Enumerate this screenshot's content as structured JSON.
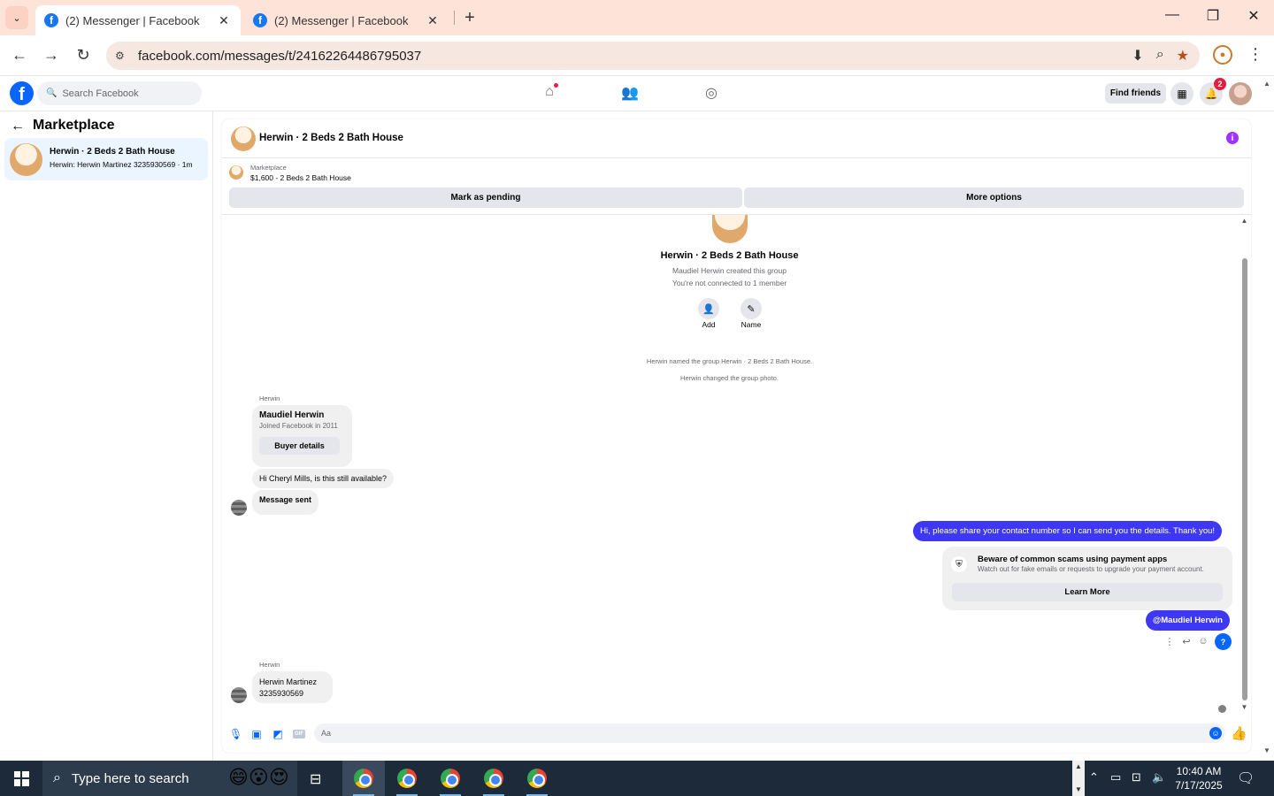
{
  "browser": {
    "tabs": [
      {
        "title": "(2) Messenger | Facebook",
        "active": true
      },
      {
        "title": "(2) Messenger | Facebook",
        "active": false
      }
    ],
    "url": "facebook.com/messages/t/24162264486795037",
    "colors": {
      "tabbar": "#fde3d8",
      "omnibox": "#f6e7e1"
    }
  },
  "fb_header": {
    "search_placeholder": "Search Facebook",
    "find_friends_label": "Find friends",
    "notification_count": "2",
    "brand_color": "#0866ff"
  },
  "sidebar": {
    "title": "Marketplace",
    "conversations": [
      {
        "name": "Herwin · 2 Beds 2 Bath House",
        "snippet": "Herwin: Herwin Martinez 3235930569 · 1m",
        "selected": true
      }
    ]
  },
  "chat": {
    "title": "Herwin · 2 Beds 2 Bath House",
    "marketplace_label": "Marketplace",
    "listing": "$1,600 - 2 Beds 2 Bath House",
    "mark_pending_label": "Mark as pending",
    "more_options_label": "More options",
    "group": {
      "name": "Herwin · 2 Beds 2 Bath House",
      "created_by": "Maudiel Herwin created this group",
      "connection": "You're not connected to 1 member",
      "add_label": "Add",
      "name_label": "Name"
    },
    "system_messages": [
      "Herwin named the group Herwin · 2 Beds 2 Bath House.",
      "Herwin changed the group photo."
    ],
    "incoming_sender": "Herwin",
    "buyer_card": {
      "name": "Maudiel Herwin",
      "joined": "Joined Facebook in 2011",
      "button": "Buyer details"
    },
    "incoming_1": "Hi Cheryl Mills, is this still available?",
    "incoming_2": "Message sent",
    "outgoing_1": "Hi, please share your contact number so I can send you the details. Thank you!",
    "scam_warning": {
      "title": "Beware of common scams using payment apps",
      "subtitle": "Watch out for fake emails or requests to upgrade your payment account.",
      "button": "Learn More"
    },
    "outgoing_2": "@Maudiel Herwin",
    "q_button": "?",
    "incoming_sender_2": "Herwin",
    "incoming_3_line1": "Herwin Martinez",
    "incoming_3_line2": "3235930569",
    "composer_placeholder": "Aa",
    "gif_label": "GIF",
    "outgoing_bubble_color": "#3e38f5"
  },
  "taskbar": {
    "search_placeholder": "Type here to search",
    "time": "10:40 AM",
    "date": "7/17/2025",
    "color": "#1c2a3a"
  }
}
